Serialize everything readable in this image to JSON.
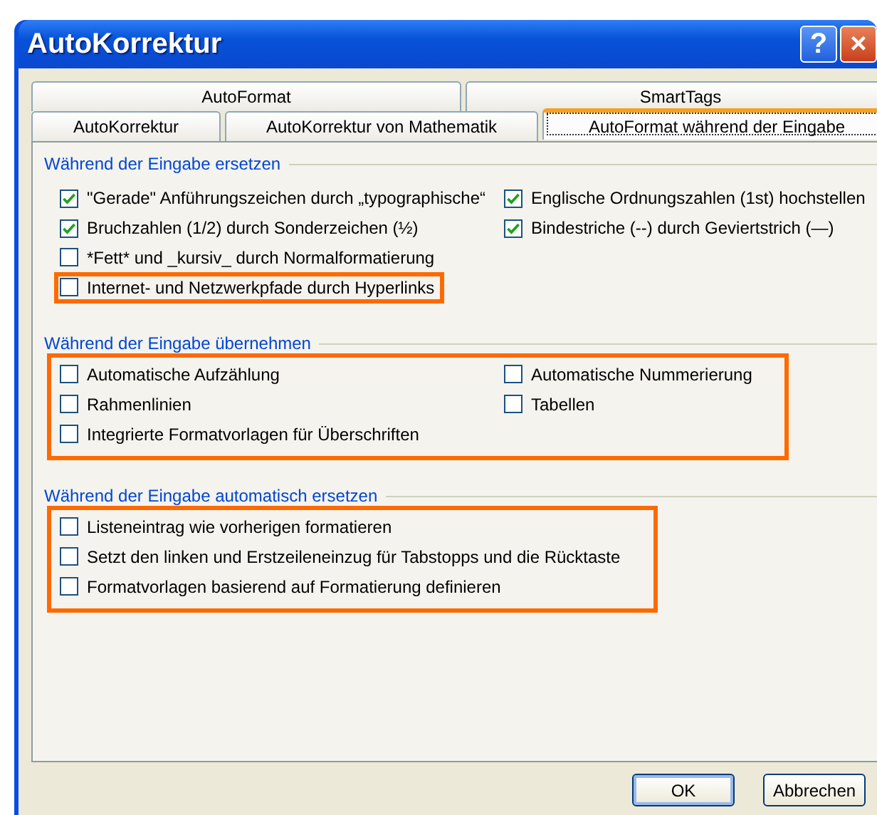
{
  "window": {
    "title": "AutoKorrektur",
    "help": "?",
    "close": "×"
  },
  "tab_rows": [
    [
      {
        "label": "AutoFormat",
        "selected": false
      },
      {
        "label": "SmartTags",
        "selected": false
      }
    ],
    [
      {
        "label": "AutoKorrektur",
        "selected": false
      },
      {
        "label": "AutoKorrektur von Mathematik",
        "selected": false
      },
      {
        "label": "AutoFormat während der Eingabe",
        "selected": true
      }
    ]
  ],
  "sections": [
    {
      "title": "Während der Eingabe ersetzen",
      "highlighted": false,
      "rows": [
        [
          {
            "label": "\"Gerade\" Anführungszeichen durch „typographische“",
            "checked": true,
            "highlighted": false
          },
          {
            "label": "Englische Ordnungszahlen (1st) hochstellen",
            "checked": true,
            "highlighted": false
          }
        ],
        [
          {
            "label": "Bruchzahlen (1/2) durch Sonderzeichen (½)",
            "checked": true,
            "highlighted": false
          },
          {
            "label": "Bindestriche (--) durch Geviertstrich (—)",
            "checked": true,
            "highlighted": false
          }
        ],
        [
          {
            "label": "*Fett* und _kursiv_ durch Normalformatierung",
            "checked": false,
            "highlighted": false
          }
        ],
        [
          {
            "label": "Internet- und Netzwerkpfade durch Hyperlinks",
            "checked": false,
            "highlighted": true
          }
        ]
      ]
    },
    {
      "title": "Während der Eingabe übernehmen",
      "highlighted": true,
      "rows": [
        [
          {
            "label": "Automatische Aufzählung",
            "checked": false,
            "highlighted": false
          },
          {
            "label": "Automatische Nummerierung",
            "checked": false,
            "highlighted": false
          }
        ],
        [
          {
            "label": "Rahmenlinien",
            "checked": false,
            "highlighted": false
          },
          {
            "label": "Tabellen",
            "checked": false,
            "highlighted": false
          }
        ],
        [
          {
            "label": "Integrierte Formatvorlagen für Überschriften",
            "checked": false,
            "highlighted": false
          }
        ]
      ]
    },
    {
      "title": "Während der Eingabe automatisch ersetzen",
      "highlighted": true,
      "rows": [
        [
          {
            "label": "Listeneintrag wie vorherigen formatieren",
            "checked": false,
            "highlighted": false
          }
        ],
        [
          {
            "label": "Setzt den linken und Erstzeileneinzug für Tabstopps und die Rücktaste",
            "checked": false,
            "highlighted": false
          }
        ],
        [
          {
            "label": "Formatvorlagen basierend auf Formatierung definieren",
            "checked": false,
            "highlighted": false
          }
        ]
      ]
    }
  ],
  "buttons": [
    {
      "label": "OK",
      "default": true
    },
    {
      "label": "Abbrechen",
      "default": false
    }
  ]
}
